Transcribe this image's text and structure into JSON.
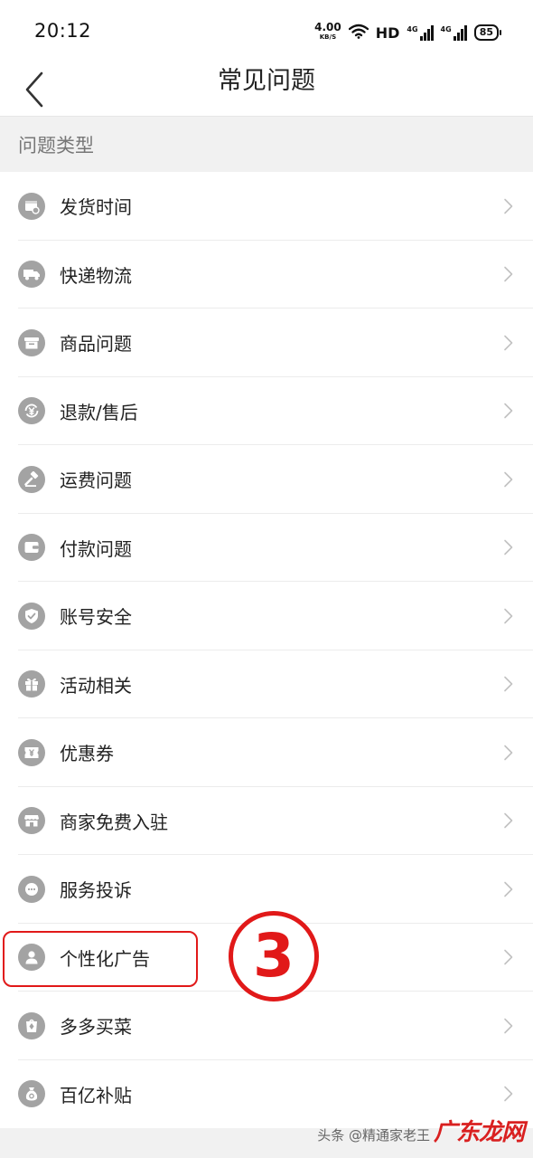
{
  "status_bar": {
    "time": "20:12",
    "net_speed": "4.00",
    "net_unit": "KB/S",
    "hd": "HD",
    "sig1": "4G",
    "sig2": "4G",
    "battery": "85"
  },
  "nav": {
    "title": "常见问题"
  },
  "section": {
    "title": "问题类型"
  },
  "items": [
    {
      "label": "发货时间",
      "icon": "calendar-clock-icon"
    },
    {
      "label": "快递物流",
      "icon": "truck-icon"
    },
    {
      "label": "商品问题",
      "icon": "box-icon"
    },
    {
      "label": "退款/售后",
      "icon": "yuan-refund-icon"
    },
    {
      "label": "运费问题",
      "icon": "hammer-icon"
    },
    {
      "label": "付款问题",
      "icon": "wallet-icon"
    },
    {
      "label": "账号安全",
      "icon": "shield-icon"
    },
    {
      "label": "活动相关",
      "icon": "gift-icon"
    },
    {
      "label": "优惠券",
      "icon": "coupon-icon"
    },
    {
      "label": "商家免费入驻",
      "icon": "store-icon"
    },
    {
      "label": "服务投诉",
      "icon": "chat-bubble-icon"
    },
    {
      "label": "个性化广告",
      "icon": "person-icon"
    },
    {
      "label": "多多买菜",
      "icon": "vegetable-bag-icon"
    },
    {
      "label": "百亿补贴",
      "icon": "money-bag-icon"
    }
  ],
  "annotation": {
    "step": "3"
  },
  "watermark": {
    "logo": "广东龙网",
    "text": "头条 @精通家老王"
  },
  "colors": {
    "accent_red": "#e11919",
    "icon_gray": "#a3a3a3"
  }
}
